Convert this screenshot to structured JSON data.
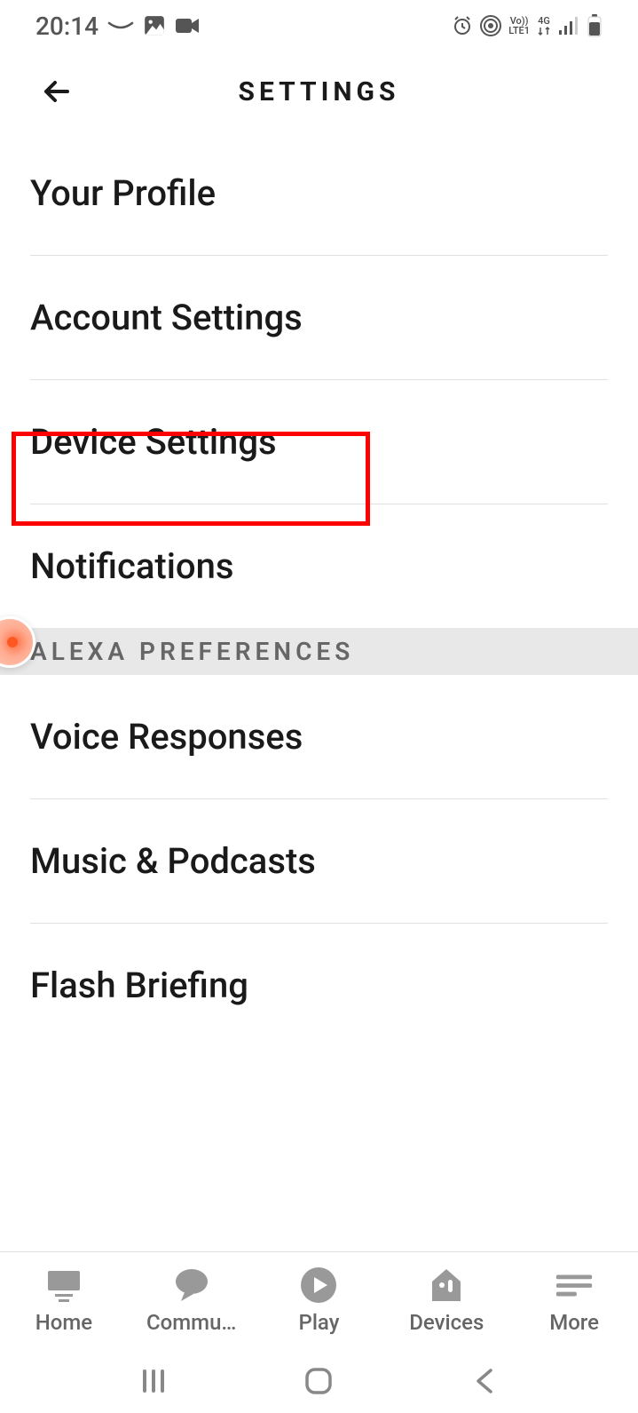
{
  "status_bar": {
    "time": "20:14",
    "network_label_top": "Vo))",
    "network_label_bottom": "LTE1",
    "network_type": "4G"
  },
  "header": {
    "title": "SETTINGS"
  },
  "settings": {
    "items": [
      {
        "label": "Your Profile"
      },
      {
        "label": "Account Settings"
      },
      {
        "label": "Device Settings"
      },
      {
        "label": "Notifications"
      }
    ]
  },
  "section": {
    "title": "ALEXA PREFERENCES"
  },
  "preferences": {
    "items": [
      {
        "label": "Voice Responses"
      },
      {
        "label": "Music & Podcasts"
      },
      {
        "label": "Flash Briefing"
      }
    ]
  },
  "bottom_nav": {
    "items": [
      {
        "label": "Home"
      },
      {
        "label": "Commu…"
      },
      {
        "label": "Play"
      },
      {
        "label": "Devices"
      },
      {
        "label": "More"
      }
    ]
  }
}
